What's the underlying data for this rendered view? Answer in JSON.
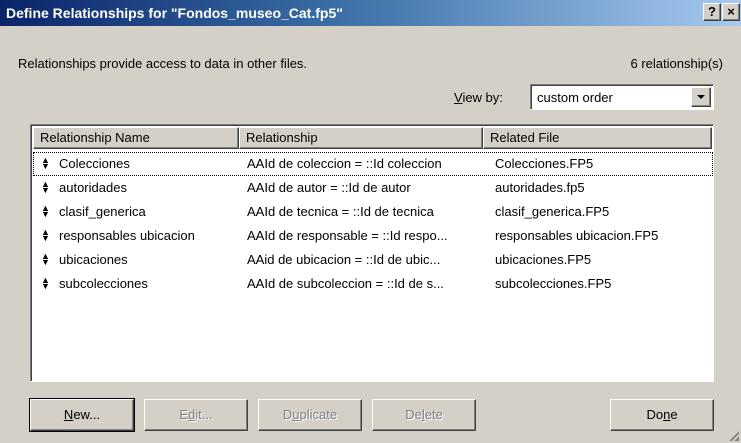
{
  "window": {
    "title": "Define Relationships for \"Fondos_museo_Cat.fp5\"",
    "help_label": "?",
    "close_label": "×"
  },
  "description": "Relationships provide access to data in other files.",
  "count": "6 relationship(s)",
  "view_by": {
    "label_underlined": "V",
    "label_rest": "iew by:",
    "selected": "custom order"
  },
  "columns": [
    "Relationship Name",
    "Relationship",
    "Related File"
  ],
  "rows": [
    {
      "name": "Colecciones",
      "relationship": "AAId de coleccion = ::Id coleccion",
      "file": "Colecciones.FP5",
      "selected": true
    },
    {
      "name": "autoridades",
      "relationship": "AAId de autor = ::Id de autor",
      "file": "autoridades.fp5"
    },
    {
      "name": "clasif_generica",
      "relationship": "AAId de tecnica = ::Id de tecnica",
      "file": "clasif_generica.FP5"
    },
    {
      "name": "responsables ubicacion",
      "relationship": "AAId de responsable = ::Id respo...",
      "file": "responsables ubicacion.FP5"
    },
    {
      "name": "ubicaciones",
      "relationship": "AAid de ubicacion = ::Id de ubic...",
      "file": "ubicaciones.FP5"
    },
    {
      "name": "subcolecciones",
      "relationship": "AAId de subcoleccion = ::Id de s...",
      "file": "subcolecciones.FP5"
    }
  ],
  "buttons": {
    "new": {
      "u": "N",
      "rest": "ew..."
    },
    "edit": {
      "pre": "E",
      "u": "d",
      "rest": "it..."
    },
    "duplicate": {
      "pre": "D",
      "u": "u",
      "rest": "plicate"
    },
    "delete": {
      "pre": "De",
      "u": "l",
      "rest": "ete"
    },
    "done": {
      "pre": "Do",
      "u": "n",
      "rest": "e"
    }
  },
  "handle_icon": "move-handle-icon"
}
